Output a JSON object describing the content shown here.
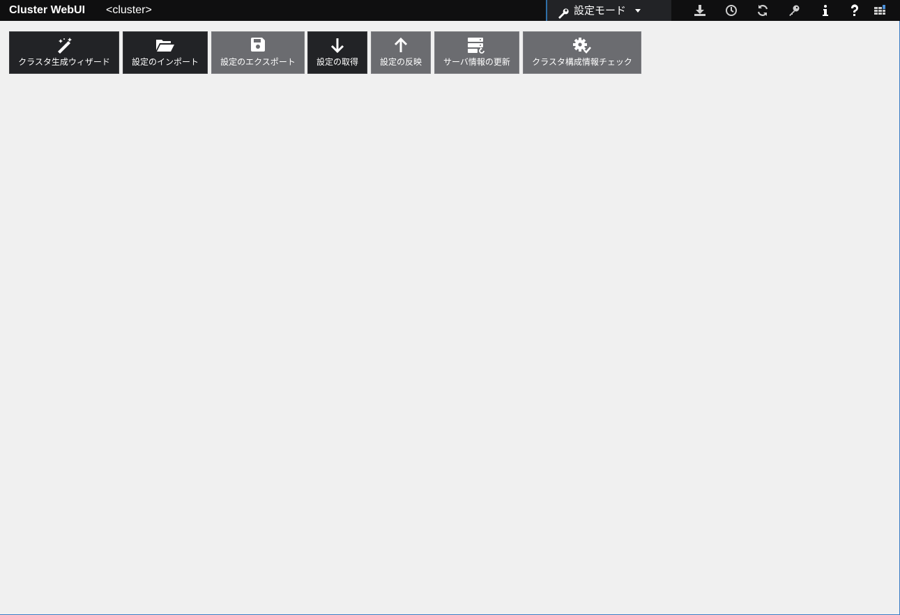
{
  "header": {
    "brand": "Cluster WebUI",
    "cluster": "<cluster>",
    "mode_label": "設定モード",
    "mode_icon": "wrench-icon",
    "tool_icons": [
      "download-icon",
      "clock-icon",
      "refresh-icon",
      "key-icon",
      "info-icon",
      "help-icon",
      "grid-icon"
    ]
  },
  "toolbar": {
    "buttons": [
      {
        "label": "クラスタ生成ウィザード",
        "icon": "magic-wand-icon",
        "style": "dark"
      },
      {
        "label": "設定のインポート",
        "icon": "folder-open-icon",
        "style": "dark"
      },
      {
        "label": "設定のエクスポート",
        "icon": "save-icon",
        "style": "gray"
      },
      {
        "label": "設定の取得",
        "icon": "arrow-down-icon",
        "style": "dark"
      },
      {
        "label": "設定の反映",
        "icon": "arrow-up-icon",
        "style": "gray"
      },
      {
        "label": "サーバ情報の更新",
        "icon": "server-refresh-icon",
        "style": "gray"
      },
      {
        "label": "クラスタ構成情報チェック",
        "icon": "gear-check-icon",
        "style": "gray"
      }
    ]
  },
  "colors": {
    "topbar_bg": "#0f0f10",
    "button_dark": "#222326",
    "button_gray": "#6b6c70",
    "page_bg": "#f0f0f0",
    "accent": "#3a7cc4"
  }
}
